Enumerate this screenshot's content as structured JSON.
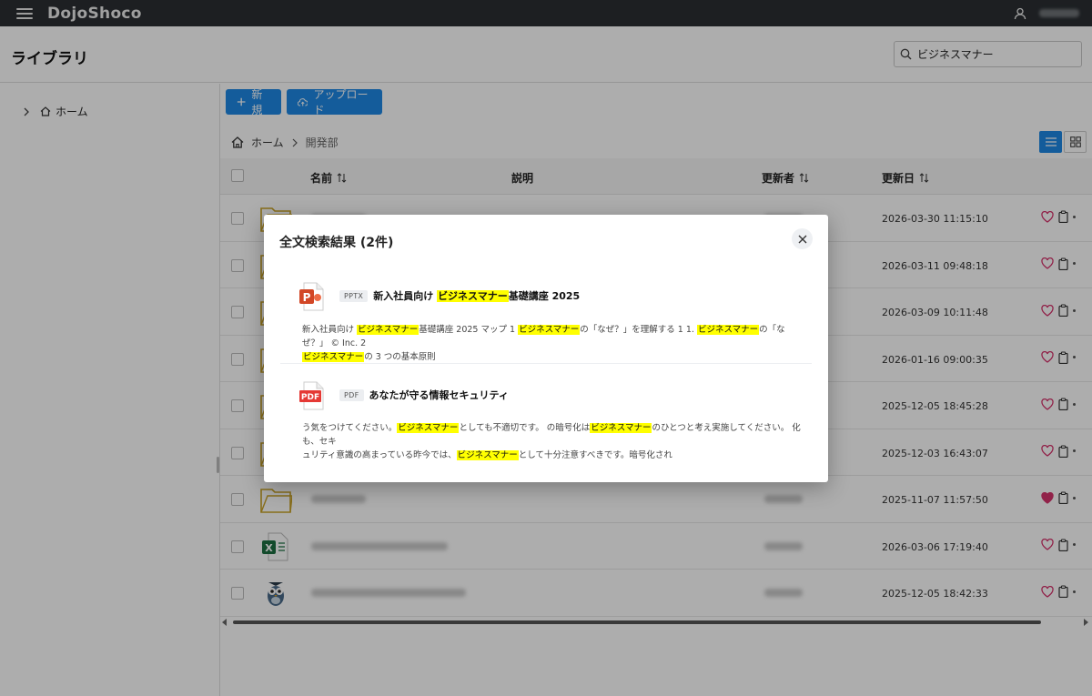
{
  "app": {
    "name": "DojoShoco"
  },
  "header": {
    "title": "ライブラリ"
  },
  "search": {
    "value": "ビジネスマナー"
  },
  "sidebar": {
    "items": [
      {
        "label": "ホーム"
      }
    ]
  },
  "toolbar": {
    "new_label": "新規",
    "upload_label": "アップロード"
  },
  "breadcrumb": {
    "home": "ホーム",
    "current": "開発部"
  },
  "table": {
    "columns": {
      "name": "名前",
      "description": "説明",
      "updated_by": "更新者",
      "updated_at": "更新日"
    },
    "rows": [
      {
        "type": "folder",
        "updated_at": "2026-03-30 11:15:10",
        "favorite": false
      },
      {
        "type": "folder",
        "updated_at": "2026-03-11 09:48:18",
        "favorite": false
      },
      {
        "type": "folder",
        "updated_at": "2026-03-09 10:11:48",
        "favorite": false
      },
      {
        "type": "folder",
        "updated_at": "2026-01-16 09:00:35",
        "favorite": false
      },
      {
        "type": "folder",
        "updated_at": "2025-12-05 18:45:28",
        "favorite": false
      },
      {
        "type": "folder",
        "updated_at": "2025-12-03 16:43:07",
        "favorite": false
      },
      {
        "type": "folder",
        "updated_at": "2025-11-07 11:57:50",
        "favorite": true
      },
      {
        "type": "excel",
        "updated_at": "2026-03-06 17:19:40",
        "favorite": false
      },
      {
        "type": "owl",
        "updated_at": "2025-12-05 18:42:33",
        "favorite": false
      }
    ]
  },
  "dialog": {
    "title": "全文検索結果 (2件)",
    "results": [
      {
        "badge": "PPTX",
        "icon": "powerpoint-icon",
        "title_pre": "新入社員向け ",
        "title_hit": "ビジネスマナー",
        "title_post": "基礎講座 2025",
        "snippet_line1": [
          {
            "t": "新入社員向け "
          },
          {
            "t": "ビジネスマナー",
            "hl": true
          },
          {
            "t": "基礎講座 2025 マップ 1 "
          },
          {
            "t": "ビジネスマナー",
            "hl": true
          },
          {
            "t": "の「なぜ？」を理解する 1 1. "
          },
          {
            "t": "ビジネスマナー",
            "hl": true
          },
          {
            "t": "の「なぜ？」 © Inc. 2"
          }
        ],
        "snippet_line2": [
          {
            "t": "ビジネスマナー",
            "hl": true
          },
          {
            "t": "の 3 つの基本原則"
          }
        ]
      },
      {
        "badge": "PDF",
        "icon": "pdf-icon",
        "title": "あなたが守る情報セキュリティ",
        "snippet_line1": [
          {
            "t": "う気をつけてください。"
          },
          {
            "t": "ビジネスマナー",
            "hl": true
          },
          {
            "t": "としても不適切です。 の暗号化は"
          },
          {
            "t": "ビジネスマナー",
            "hl": true
          },
          {
            "t": "のひとつと考え実施してください。 化も、セキ"
          }
        ],
        "snippet_line2": [
          {
            "t": "ュリティ意識の高まっている昨今では、"
          },
          {
            "t": "ビジネスマナー",
            "hl": true
          },
          {
            "t": "として十分注意すべきです。暗号化され"
          }
        ]
      }
    ]
  },
  "colors": {
    "primary": "#1e88e5",
    "topbar": "#2b2f33",
    "highlight": "#ffff00",
    "favorite": "#d6336c",
    "folder": "#c9a227"
  }
}
